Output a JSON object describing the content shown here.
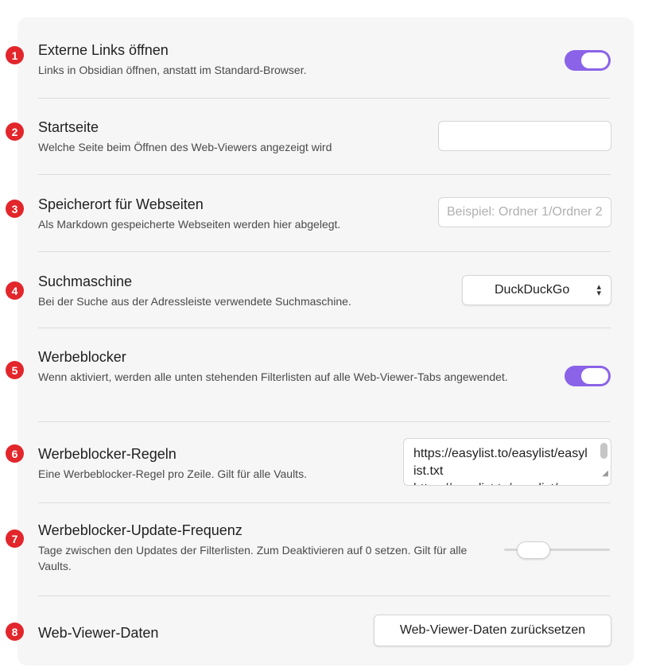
{
  "settings": {
    "external_links": {
      "badge": "1",
      "title": "Externe Links öffnen",
      "description": "Links in Obsidian öffnen, anstatt im Standard-Browser.",
      "enabled": true
    },
    "homepage": {
      "badge": "2",
      "title": "Startseite",
      "description": "Welche Seite beim Öffnen des Web-Viewers angezeigt wird",
      "value": ""
    },
    "save_location": {
      "badge": "3",
      "title": "Speicherort für Webseiten",
      "description": "Als Markdown gespeicherte Webseiten werden hier abgelegt.",
      "placeholder": "Beispiel: Ordner 1/Ordner 2"
    },
    "search_engine": {
      "badge": "4",
      "title": "Suchmaschine",
      "description": "Bei der Suche aus der Adressleiste verwendete Suchmaschine.",
      "selected": "DuckDuckGo"
    },
    "adblocker": {
      "badge": "5",
      "title": "Werbeblocker",
      "description": "Wenn aktiviert, werden alle unten stehenden Filterlisten auf alle Web-Viewer-Tabs angewendet.",
      "enabled": true
    },
    "adblocker_rules": {
      "badge": "6",
      "title": "Werbeblocker-Regeln",
      "description": "Eine Werbeblocker-Regel pro Zeile. Gilt für alle Vaults.",
      "value": "https://easylist.to/easylist/easylist.txt\nhttps://easylist.to/easylist/easyprivacy.txt"
    },
    "adblocker_update_frequency": {
      "badge": "7",
      "title": "Werbeblocker-Update-Frequenz",
      "description": "Tage zwischen den Updates der Filterlisten. Zum Deaktivieren auf 0 setzen. Gilt für alle Vaults.",
      "slider_fraction": 0.18
    },
    "webviewer_data": {
      "badge": "8",
      "title": "Web-Viewer-Daten",
      "button_label": "Web-Viewer-Daten zurücksetzen"
    }
  },
  "colors": {
    "accent": "#8b63e8",
    "badge": "#e2262b"
  }
}
